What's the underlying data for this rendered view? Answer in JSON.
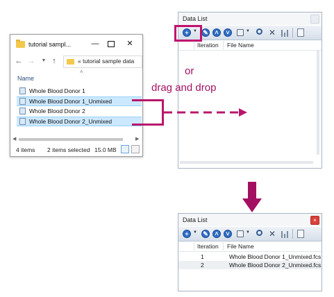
{
  "explorer": {
    "title": "tutorial sampl...",
    "address": "« tutorial sample data",
    "column_name": "Name",
    "files": [
      {
        "name": "Whole Blood Donor 1",
        "selected": false
      },
      {
        "name": "Whole Blood Donor 1_Unmixed",
        "selected": true
      },
      {
        "name": "Whole Blood Donor 2",
        "selected": false
      },
      {
        "name": "Whole Blood Donor 2_Unmixed",
        "selected": true
      }
    ],
    "status": {
      "item_count": "4 items",
      "selected": "2 items selected",
      "size": "15.0 MB"
    },
    "icons": [
      "folder-icon",
      "minimize-icon",
      "maximize-icon",
      "close-icon",
      "back-arrow-icon",
      "forward-arrow-icon",
      "recent-dropdown-icon",
      "up-arrow-icon",
      "details-view-icon",
      "large-icons-view-icon"
    ]
  },
  "data_list_top": {
    "title": "Data List",
    "columns": [
      "Iteration",
      "File Name"
    ]
  },
  "data_list_bottom": {
    "title": "Data List",
    "columns": [
      "Iteration",
      "File Name"
    ],
    "rows": [
      {
        "iteration": "1",
        "file_name": "Whole Blood Donor 1_Unmixed.fcs"
      },
      {
        "iteration": "2",
        "file_name": "Whole Blood Donor 2_Unmixed.fcs"
      }
    ]
  },
  "toolbar_icons": [
    "add-icon",
    "dropdown-caret-icon",
    "edit-icon",
    "move-up-icon",
    "move-down-icon",
    "copy-icon",
    "dropdown-caret-icon",
    "search-icon",
    "delete-icon",
    "columns-icon",
    "properties-icon"
  ],
  "annotations": {
    "or": "or",
    "drag_and_drop": "drag and drop"
  },
  "colors": {
    "accent": "#a31062",
    "selection": "#cce8ff",
    "toolbar_icon": "#2f6dc4",
    "close_red": "#d9403a"
  }
}
